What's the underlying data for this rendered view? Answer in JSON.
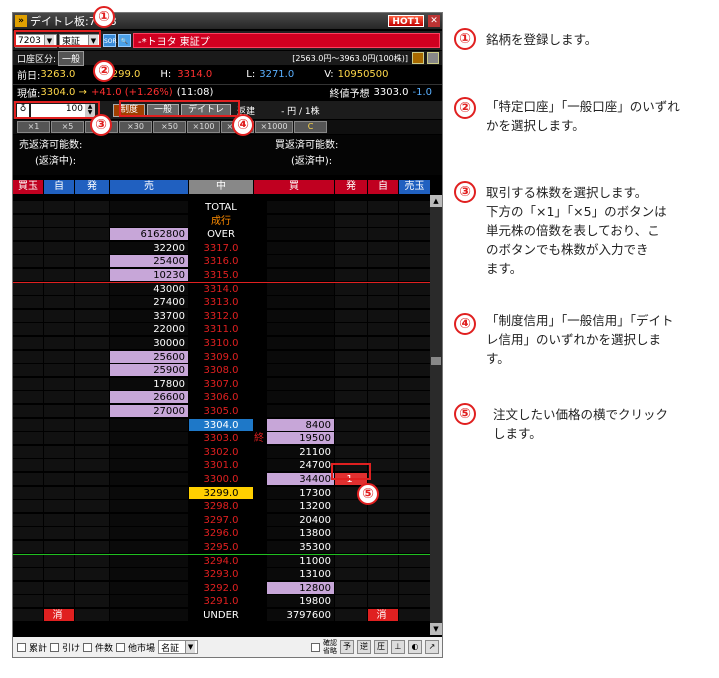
{
  "window": {
    "title": "デイトレ板:7203",
    "hot_label": "HOT1",
    "close": "✕"
  },
  "symbol": {
    "code": "7203",
    "market": "東証",
    "icon_label": "SOR\nOFF",
    "name": "-*トヨタ 東証プ"
  },
  "account": {
    "label": "口座区分:",
    "button": "一般",
    "range": "[2563.0円～3963.0円(100株)]"
  },
  "prices": {
    "prev_label": "前日:",
    "prev": "3263.0",
    "open": "3299.0",
    "high_label": "H:",
    "high": "3314.0",
    "low_label": "L:",
    "low": "3271.0",
    "vol_label": "V:",
    "vol": "10950500",
    "now_label": "現値:",
    "now": "3304.0 →",
    "change": "+41.0 (+1.26%)",
    "time": "(11:08)",
    "close_label": "終値予想",
    "close_pred": "3303.0",
    "close_change": "-1.0"
  },
  "order": {
    "qty": "100",
    "types": [
      "制度",
      "一般",
      "デイトレ"
    ],
    "hen": "返建",
    "yen": "- 円 / 1株",
    "mults": [
      "×1",
      "×5",
      "×10",
      "×30",
      "×50",
      "×100",
      "×500",
      "×1000",
      "C"
    ]
  },
  "returnable": {
    "sell_label": "売返済可能数:",
    "sell_pending": "(返済中):",
    "buy_label": "買返済可能数:",
    "buy_pending": "(返済中):"
  },
  "headers": {
    "kaigyoku": "買玉",
    "ji1": "自",
    "hatsu1": "発",
    "uri": "売",
    "naka": "中",
    "kai": "買",
    "hatsu2": "発",
    "ji2": "自",
    "urigyoku": "売玉"
  },
  "book_rows": [
    {
      "mid": "TOTAL",
      "mc": "#fff"
    },
    {
      "mid": "成行",
      "mc": "#ff8c00"
    },
    {
      "sell": "6162800",
      "mid": "OVER",
      "mc": "#fff",
      "sp": 1
    },
    {
      "sell": "32200",
      "mid": "3317.0",
      "mc": "#e02020"
    },
    {
      "sell": "25400",
      "mid": "3316.0",
      "mc": "#e02020",
      "sp": 1
    },
    {
      "sell": "10230",
      "mid": "3315.0",
      "mc": "#e02020",
      "sp": 1,
      "redline": 1
    },
    {
      "sell": "43000",
      "mid": "3314.0",
      "mc": "#e02020"
    },
    {
      "sell": "27400",
      "mid": "3313.0",
      "mc": "#e02020"
    },
    {
      "sell": "33700",
      "mid": "3312.0",
      "mc": "#e02020"
    },
    {
      "sell": "22000",
      "mid": "3311.0",
      "mc": "#e02020"
    },
    {
      "sell": "30000",
      "mid": "3310.0",
      "mc": "#e02020"
    },
    {
      "sell": "25600",
      "mid": "3309.0",
      "mc": "#e02020",
      "sp": 1
    },
    {
      "sell": "25900",
      "mid": "3308.0",
      "mc": "#e02020",
      "sp": 1
    },
    {
      "sell": "17800",
      "mid": "3307.0",
      "mc": "#e02020"
    },
    {
      "sell": "26600",
      "mid": "3306.0",
      "mc": "#e02020",
      "sp": 1
    },
    {
      "sell": "27000",
      "mid": "3305.0",
      "mc": "#e02020",
      "sp": 1
    },
    {
      "mid": "3304.0",
      "mc": "#fff",
      "mbg": "#1e78c8",
      "buy": "8400",
      "bp": 1
    },
    {
      "mid": "3303.0",
      "mc": "#e02020",
      "buy": "19500",
      "bp": 1,
      "mark": "終"
    },
    {
      "mid": "3302.0",
      "mc": "#e02020",
      "buy": "21100"
    },
    {
      "mid": "3301.0",
      "mc": "#e02020",
      "buy": "24700"
    },
    {
      "mid": "3300.0",
      "mc": "#e02020",
      "buy": "34400",
      "bp": 1,
      "order": "1"
    },
    {
      "mid": "3299.0",
      "mc": "#000",
      "mbg": "#ffd000",
      "buy": "17300"
    },
    {
      "mid": "3298.0",
      "mc": "#e02020",
      "buy": "13200"
    },
    {
      "mid": "3297.0",
      "mc": "#e02020",
      "buy": "20400"
    },
    {
      "mid": "3296.0",
      "mc": "#e02020",
      "buy": "13800"
    },
    {
      "mid": "3295.0",
      "mc": "#e02020",
      "buy": "35300",
      "greenline": 1
    },
    {
      "mid": "3294.0",
      "mc": "#e02020",
      "buy": "11000"
    },
    {
      "mid": "3293.0",
      "mc": "#e02020",
      "buy": "13100"
    },
    {
      "mid": "3292.0",
      "mc": "#e02020",
      "buy": "12800",
      "bp": 1
    },
    {
      "mid": "3291.0",
      "mc": "#e02020",
      "buy": "19800"
    },
    {
      "mid": "UNDER",
      "mc": "#fff",
      "buy": "3797600",
      "kesu": "消"
    }
  ],
  "footer": {
    "items": [
      "累計",
      "引け",
      "件数",
      "他市場"
    ],
    "market_sel": "名証",
    "confirm": "確認\n省略"
  },
  "annotations": [
    {
      "n": "①",
      "text": "銘柄を登録します。"
    },
    {
      "n": "②",
      "text": "「特定口座」「一般口座」のいずれ\nかを選択します。"
    },
    {
      "n": "③",
      "text": "取引する株数を選択します。\n下方の「×1」「×5」のボタンは\n単元株の倍数を表しており、こ\nのボタンでも株数が入力でき\nます。"
    },
    {
      "n": "④",
      "text": "「制度信用」「一般信用」「デイト\nレ信用」のいずれかを選択しま\nす。"
    },
    {
      "n": "⑤",
      "text": "注文したい価格の横でクリック\nします。"
    }
  ]
}
